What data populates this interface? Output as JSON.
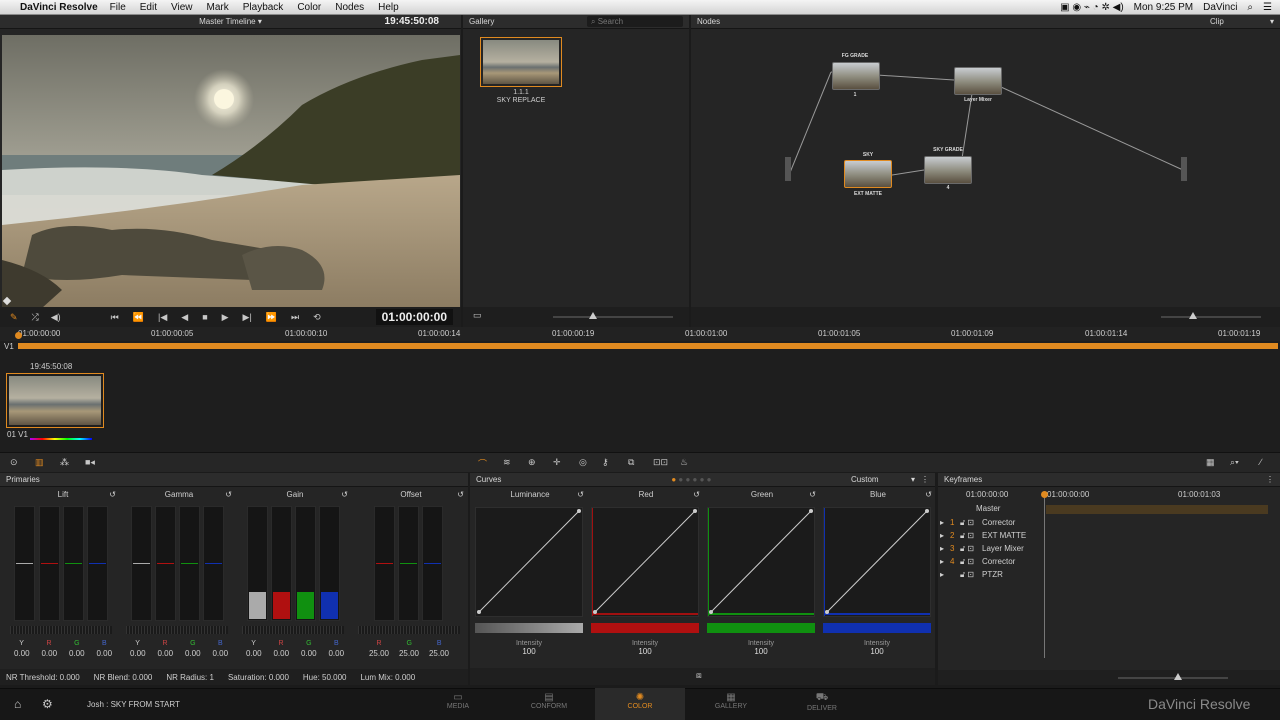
{
  "menubar": {
    "apple": "",
    "app": "DaVinci Resolve",
    "items": [
      "File",
      "Edit",
      "View",
      "Mark",
      "Playback",
      "Color",
      "Nodes",
      "Help"
    ],
    "clock": "Mon 9:25 PM",
    "user": "DaVinci"
  },
  "viewer": {
    "timeline_name": "Master Timeline",
    "timecode_top": "19:45:50:08",
    "timecode": "01:00:00:00"
  },
  "gallery": {
    "title": "Gallery",
    "search_placeholder": "Search",
    "still_id": "1.1.1",
    "still_name": "SKY REPLACE"
  },
  "nodes": {
    "title": "Nodes",
    "mode": "Clip",
    "n1_label": "FG GRADE",
    "n1_num": "1",
    "n2_label": "Layer Mixer",
    "n3_label": "SKY",
    "n3_sub": "EXT MATTE",
    "n4_label": "SKY GRADE",
    "n4_num": "4"
  },
  "timeline": {
    "ticks": [
      "01:00:00:00",
      "01:00:00:05",
      "01:00:00:10",
      "01:00:00:14",
      "01:00:00:19",
      "01:00:01:00",
      "01:00:01:05",
      "01:00:01:09",
      "01:00:01:14",
      "01:00:01:19"
    ],
    "track": "V1",
    "clip_tc": "19:45:50:08",
    "clip_name": "01 V1"
  },
  "primaries": {
    "title": "Primaries",
    "wheels": [
      {
        "name": "Lift",
        "vals": [
          "0.00",
          "0.00",
          "0.00",
          "0.00"
        ]
      },
      {
        "name": "Gamma",
        "vals": [
          "0.00",
          "0.00",
          "0.00",
          "0.00"
        ]
      },
      {
        "name": "Gain",
        "vals": [
          "0.00",
          "0.00",
          "0.00",
          "0.00"
        ]
      },
      {
        "name": "Offset",
        "vals": [
          "25.00",
          "25.00",
          "25.00"
        ]
      }
    ],
    "ch": [
      "Y",
      "R",
      "G",
      "B"
    ],
    "ch3": [
      "R",
      "G",
      "B"
    ],
    "footer": {
      "nr_threshold": "NR Threshold:  0.000",
      "nr_blend": "NR Blend:  0.000",
      "nr_radius": "NR Radius:  1",
      "saturation": "Saturation:  0.000",
      "hue": "Hue:  50.000",
      "lum_mix": "Lum Mix:  0.000"
    }
  },
  "curves": {
    "title": "Curves",
    "preset": "Custom",
    "channels": [
      "Luminance",
      "Red",
      "Green",
      "Blue"
    ],
    "intensity_label": "Intensity",
    "intensity_val": "100"
  },
  "keyframes": {
    "title": "Keyframes",
    "tc0": "01:00:00:00",
    "tc1": "01:00:00:00",
    "tc2": "01:00:01:03",
    "master": "Master",
    "rows": [
      {
        "num": "1",
        "name": "Corrector"
      },
      {
        "num": "2",
        "name": "EXT MATTE"
      },
      {
        "num": "3",
        "name": "Layer Mixer"
      },
      {
        "num": "4",
        "name": "Corrector"
      },
      {
        "num": "",
        "name": "PTZR"
      }
    ]
  },
  "status": {
    "project": "Josh : SKY FROM START",
    "brand": "DaVinci Resolve"
  },
  "dock": [
    "MEDIA",
    "CONFORM",
    "COLOR",
    "GALLERY",
    "DELIVER"
  ],
  "colors": {
    "accent": "#e08a20",
    "red": "#b01010",
    "green": "#109010",
    "blue": "#1030b0"
  }
}
